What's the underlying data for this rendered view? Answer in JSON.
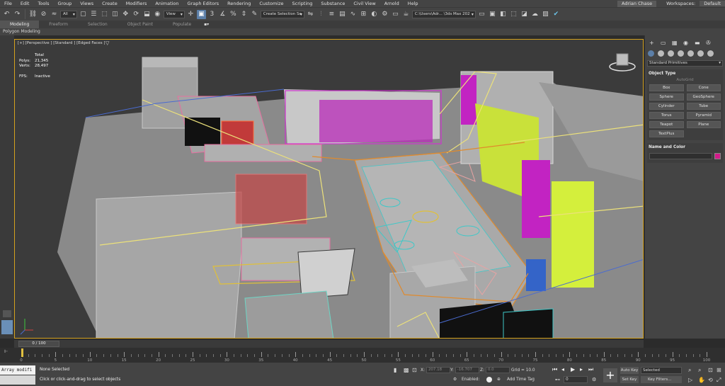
{
  "menu": {
    "items": [
      "File",
      "Edit",
      "Tools",
      "Group",
      "Views",
      "Create",
      "Modifiers",
      "Animation",
      "Graph Editors",
      "Rendering",
      "Customize",
      "Scripting",
      "Substance",
      "Civil View",
      "Arnold",
      "Help"
    ],
    "user": "Adrian Chase",
    "workspaces_label": "Workspaces:",
    "workspaces_value": "Default"
  },
  "toolbar": {
    "filter_value": "All",
    "refcoord_value": "View",
    "selection_set_placeholder": "Create Selection Se",
    "project_path": "C:\\Users\\Adr... \\3ds Max 202"
  },
  "ribbon": {
    "tabs": [
      "Modeling",
      "Freeform",
      "Selection",
      "Object Paint",
      "Populate"
    ],
    "active_tab": "Modeling",
    "sub_label": "Polygon Modeling"
  },
  "viewport": {
    "label": "[+] [Perspective ] [Standard ] [Edged Faces ]",
    "stats": {
      "total_label": "Total",
      "polys_label": "Polys:",
      "polys_value": "21,345",
      "verts_label": "Verts:",
      "verts_value": "28,497",
      "fps_label": "FPS:",
      "fps_value": "Inactive"
    }
  },
  "command_panel": {
    "category": "Standard Primitives",
    "object_type_title": "Object Type",
    "autogrid": "AutoGrid",
    "buttons": [
      "Box",
      "Cone",
      "Sphere",
      "GeoSphere",
      "Cylinder",
      "Tube",
      "Torus",
      "Pyramid",
      "Teapot",
      "Plane",
      "TextPlus"
    ],
    "name_color_title": "Name and Color",
    "object_color": "#d21a8a"
  },
  "timeline": {
    "frame_display": "0 / 100",
    "ticks": [
      "0",
      "5",
      "10",
      "15",
      "20",
      "25",
      "30",
      "35",
      "40",
      "45",
      "50",
      "55",
      "60",
      "65",
      "70",
      "75",
      "80",
      "85",
      "90",
      "95",
      "100"
    ]
  },
  "status": {
    "maxscript": "Array modifi",
    "selection_status": "None Selected",
    "prompt": "Click or click-and-drag to select objects",
    "x_label": "X:",
    "x_value": "207.18",
    "y_label": "Y:",
    "y_value": "-16.707",
    "z_label": "Z:",
    "z_value": "0.0",
    "grid": "Grid = 10.0",
    "enabled_label": "Enabled:",
    "add_time_tag": "Add Time Tag",
    "auto_key": "Auto Key",
    "set_key": "Set Key",
    "key_mode": "Selected",
    "key_filters": "Key Filters...",
    "current_frame": "0"
  }
}
